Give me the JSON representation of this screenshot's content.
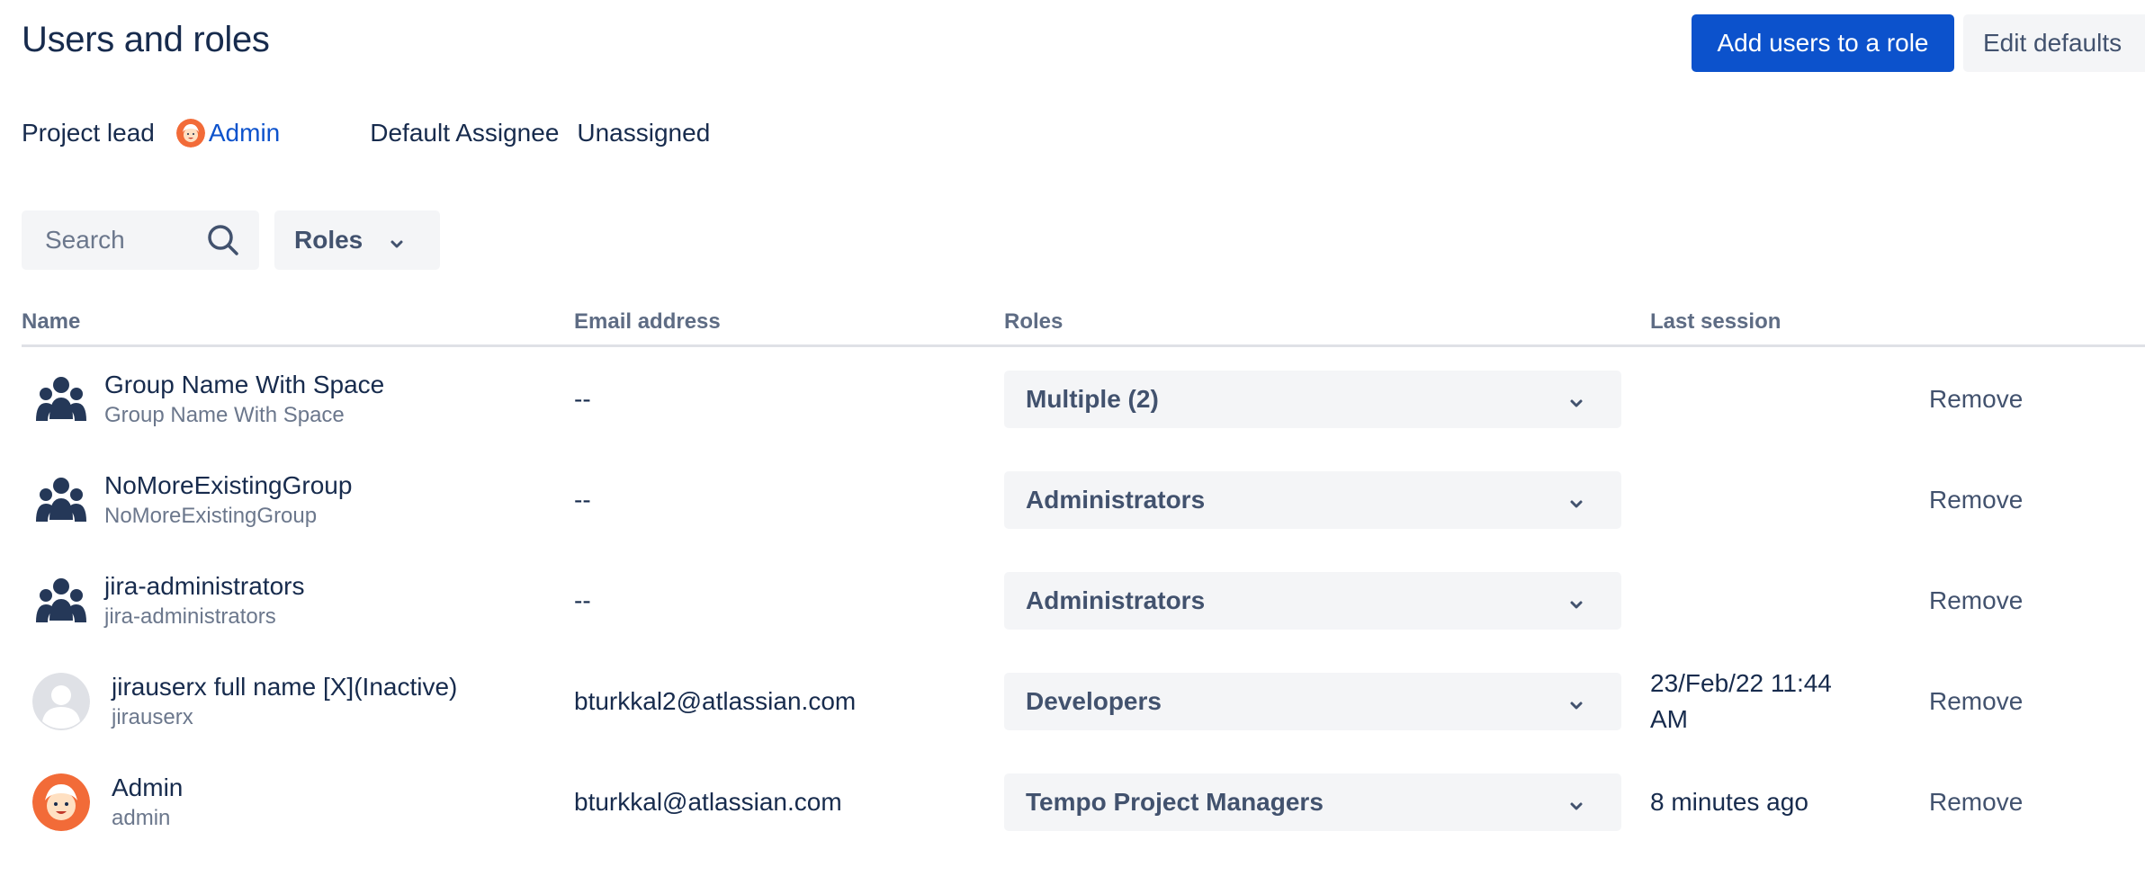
{
  "header": {
    "title": "Users and roles",
    "add_users_label": "Add users to a role",
    "edit_defaults_label": "Edit defaults"
  },
  "meta": {
    "project_lead_label": "Project lead",
    "project_lead_value": "Admin",
    "default_assignee_label": "Default Assignee",
    "default_assignee_value": "Unassigned"
  },
  "filters": {
    "search_placeholder": "Search",
    "roles_label": "Roles"
  },
  "table": {
    "columns": [
      "Name",
      "Email address",
      "Roles",
      "Last session"
    ],
    "rows": [
      {
        "type": "group",
        "name": "Group Name With Space",
        "subname": "Group Name With Space",
        "email": "--",
        "role": "Multiple (2)",
        "last_session": "",
        "action": "Remove"
      },
      {
        "type": "group",
        "name": "NoMoreExistingGroup",
        "subname": "NoMoreExistingGroup",
        "email": "--",
        "role": "Administrators",
        "last_session": "",
        "action": "Remove"
      },
      {
        "type": "group",
        "name": "jira-administrators",
        "subname": "jira-administrators",
        "email": "--",
        "role": "Administrators",
        "last_session": "",
        "action": "Remove"
      },
      {
        "type": "user-default",
        "name": "jirauserx full name [X](Inactive)",
        "subname": "jirauserx",
        "email": "bturkkal2@atlassian.com",
        "role": "Developers",
        "last_session": "23/Feb/22 11:44 AM",
        "action": "Remove"
      },
      {
        "type": "user-admin",
        "name": "Admin",
        "subname": "admin",
        "email": "bturkkal@atlassian.com",
        "role": "Tempo Project Managers",
        "last_session": "8 minutes ago",
        "action": "Remove"
      }
    ]
  },
  "icons": {
    "group": "group-icon",
    "default_user": "default-user-avatar-icon",
    "admin_user": "admin-avatar-icon",
    "search": "search-icon",
    "chevron": "chevron-down-icon"
  },
  "colors": {
    "primary": "#0c52cc",
    "text": "#172b4d",
    "subtle_text": "#6b778c",
    "field_bg": "#f4f5f7",
    "avatar_orange": "#f26b38"
  }
}
